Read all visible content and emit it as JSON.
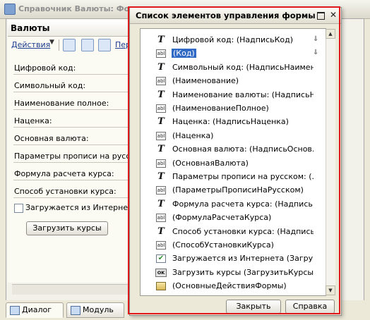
{
  "background_window": {
    "title": "Справочник Валюты: Фор",
    "form_header": "Валюты",
    "toolbar": {
      "actions_label": "Действия",
      "next_label": "Пер"
    },
    "fields": [
      "Цифровой код:",
      "Символьный код:",
      "Наименование полное:",
      "Наценка:",
      "Основная валюта:",
      "Параметры прописи на русском:",
      "Формула расчета курса:",
      "Способ установки курса:"
    ],
    "checkbox_label": "Загружается из Интернета",
    "button_label": "Загрузить курсы",
    "tabs": [
      "Диалог",
      "Модуль"
    ]
  },
  "dialog": {
    "title": "Список элементов управления формы",
    "items": [
      {
        "icon": "T",
        "label": "Цифровой код: (НадписьКод)",
        "extra": "ctrl-icon"
      },
      {
        "icon": "abl",
        "label": "(Код)",
        "selected": true,
        "extra": "ctrl-icon"
      },
      {
        "icon": "T",
        "label": "Символьный код: (НадписьНаимен..."
      },
      {
        "icon": "abl",
        "label": "(Наименование)"
      },
      {
        "icon": "T",
        "label": "Наименование валюты: (НадписьН..."
      },
      {
        "icon": "abl",
        "label": "(НаименованиеПолное)"
      },
      {
        "icon": "T",
        "label": "Наценка: (НадписьНаценка)"
      },
      {
        "icon": "abl",
        "label": "(Наценка)"
      },
      {
        "icon": "T",
        "label": "Основная валюта: (НадписьОснов..."
      },
      {
        "icon": "abl",
        "label": "(ОсновнаяВалюта)"
      },
      {
        "icon": "T",
        "label": "Параметры прописи на русском: (..."
      },
      {
        "icon": "abl",
        "label": "(ПараметрыПрописиНаРусском)"
      },
      {
        "icon": "T",
        "label": "Формула расчета курса: (Надпись..."
      },
      {
        "icon": "abl",
        "label": "(ФормулаРасчетаКурса)"
      },
      {
        "icon": "T",
        "label": "Способ установки курса: (Надпись..."
      },
      {
        "icon": "abl",
        "label": "(СпособУстановкиКурса)"
      },
      {
        "icon": "check",
        "label": "Загружается из Интернета (Загру..."
      },
      {
        "icon": "OK",
        "label": "Загрузить курсы (ЗагрузитьКурсы)"
      },
      {
        "icon": "panel",
        "label": "(ОсновныеДействияФормы)"
      }
    ],
    "icon_text": {
      "T": "T",
      "abl": "abl",
      "OK": "OK",
      "check": "✔"
    },
    "buttons": {
      "close": "Закрыть",
      "help": "Справка"
    }
  },
  "colors": {
    "highlight_frame": "#e0191c",
    "selection": "#316ac5"
  }
}
